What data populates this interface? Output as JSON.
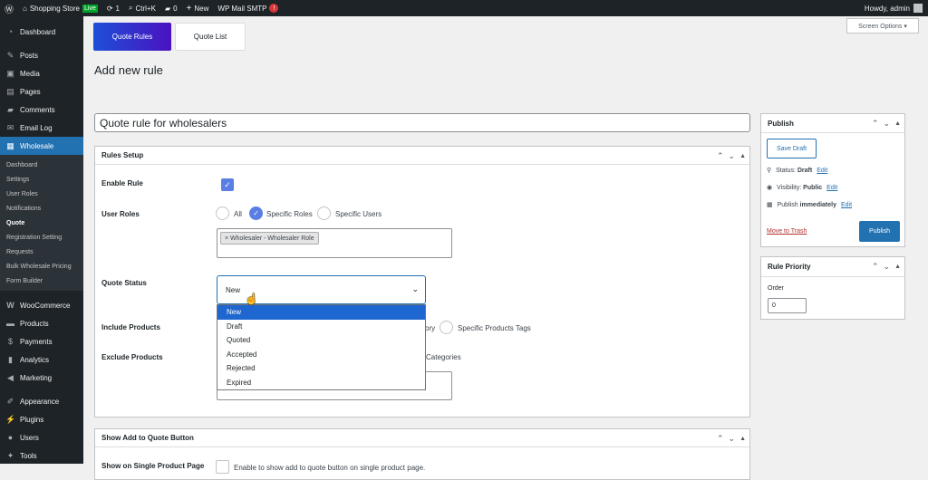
{
  "adminbar": {
    "site_name": "Shopping Store",
    "live_badge": "Live",
    "updates_count": "1",
    "search_label": "Ctrl+K",
    "comments_count": "0",
    "new_label": "New",
    "smtp_label": "WP Mail SMTP",
    "smtp_alert": "!",
    "howdy": "Howdy, admin"
  },
  "sidebar": {
    "items_top": [
      {
        "label": "Dashboard",
        "icon": "dashboard-icon"
      }
    ],
    "items_mid": [
      {
        "label": "Posts",
        "icon": "pin-icon"
      },
      {
        "label": "Media",
        "icon": "media-icon"
      },
      {
        "label": "Pages",
        "icon": "pages-icon"
      },
      {
        "label": "Comments",
        "icon": "comment-icon"
      },
      {
        "label": "Email Log",
        "icon": "email-icon"
      }
    ],
    "active": {
      "label": "Wholesale",
      "icon": "wholesale-icon"
    },
    "submenu": [
      "Dashboard",
      "Settings",
      "User Roles",
      "Notifications",
      "Quote",
      "Registration Setting",
      "Requests",
      "Bulk Wholesale Pricing",
      "Form Builder"
    ],
    "current_sub": "Quote",
    "items_bottom": [
      {
        "label": "WooCommerce",
        "icon": "woo-icon"
      },
      {
        "label": "Products",
        "icon": "products-icon"
      },
      {
        "label": "Payments",
        "icon": "payments-icon"
      },
      {
        "label": "Analytics",
        "icon": "analytics-icon"
      },
      {
        "label": "Marketing",
        "icon": "marketing-icon"
      }
    ],
    "items_tail": [
      {
        "label": "Appearance",
        "icon": "appearance-icon"
      },
      {
        "label": "Plugins",
        "icon": "plugins-icon"
      },
      {
        "label": "Users",
        "icon": "users-icon"
      },
      {
        "label": "Tools",
        "icon": "tools-icon"
      }
    ]
  },
  "tabs": {
    "rules": "Quote Rules",
    "list": "Quote List"
  },
  "screen_options": "Screen Options ▾",
  "page_title": "Add new rule",
  "rule_title": "Quote rule for wholesalers",
  "rules_setup": {
    "heading": "Rules Setup",
    "enable_rule_label": "Enable Rule",
    "user_roles_label": "User Roles",
    "radio_all": "All",
    "radio_specific_roles": "Specific Roles",
    "radio_specific_users": "Specific Users",
    "selected_role_tag": "× Wholesaler - Wholesaler Role",
    "quote_status_label": "Quote Status",
    "quote_status_value": "New",
    "status_options": [
      "New",
      "Draft",
      "Quoted",
      "Accepted",
      "Rejected",
      "Expired"
    ],
    "highlighted_option": "New",
    "include_products_label": "Include Products",
    "include_partial": "ory",
    "include_tags": "Specific Products Tags",
    "exclude_products_label": "Exclude Products",
    "exclude_partial": "Categories"
  },
  "add_quote": {
    "heading": "Show Add to Quote Button",
    "single_label": "Show on Single Product Page",
    "single_help": "Enable to show add to quote button on single product page."
  },
  "publish": {
    "heading": "Publish",
    "save_draft": "Save Draft",
    "status_text": "Status: ",
    "status_value": "Draft",
    "edit": "Edit",
    "visibility_text": "Visibility: ",
    "visibility_value": "Public",
    "publish_text": "Publish ",
    "publish_value": "immediately",
    "trash": "Move to Trash",
    "publish_btn": "Publish"
  },
  "priority": {
    "heading": "Rule Priority",
    "order_label": "Order",
    "order_value": "0"
  }
}
